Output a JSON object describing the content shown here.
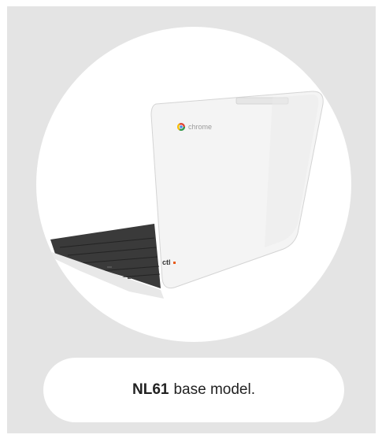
{
  "product": {
    "image_brand_mark": "chrome",
    "image_maker_mark": "ctl",
    "caption_model": "NL61",
    "caption_text": "base model."
  },
  "colors": {
    "card_background": "#e4e4e4",
    "circle_background": "#ffffff",
    "laptop_shell": "#f4f4f4",
    "keyboard": "#3a3a3a",
    "maker_accent": "#e85a1a"
  },
  "icons": [
    "chrome-logo-icon"
  ]
}
